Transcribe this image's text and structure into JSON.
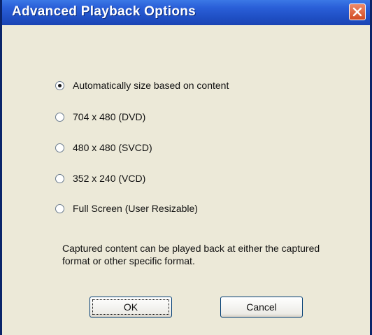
{
  "window": {
    "title": "Advanced Playback Options"
  },
  "options": [
    {
      "label": "Automatically size based on content",
      "checked": true
    },
    {
      "label": "704 x 480 (DVD)",
      "checked": false
    },
    {
      "label": "480 x 480 (SVCD)",
      "checked": false
    },
    {
      "label": "352 x 240 (VCD)",
      "checked": false
    },
    {
      "label": "Full Screen (User Resizable)",
      "checked": false
    }
  ],
  "description": "Captured content can be played back at either the captured format or other specific format.",
  "buttons": {
    "ok_label": "OK",
    "cancel_label": "Cancel"
  },
  "colors": {
    "titlebar": "#2a5fd8",
    "dialog_background": "#ece9d8",
    "close_button": "#d24b22"
  }
}
